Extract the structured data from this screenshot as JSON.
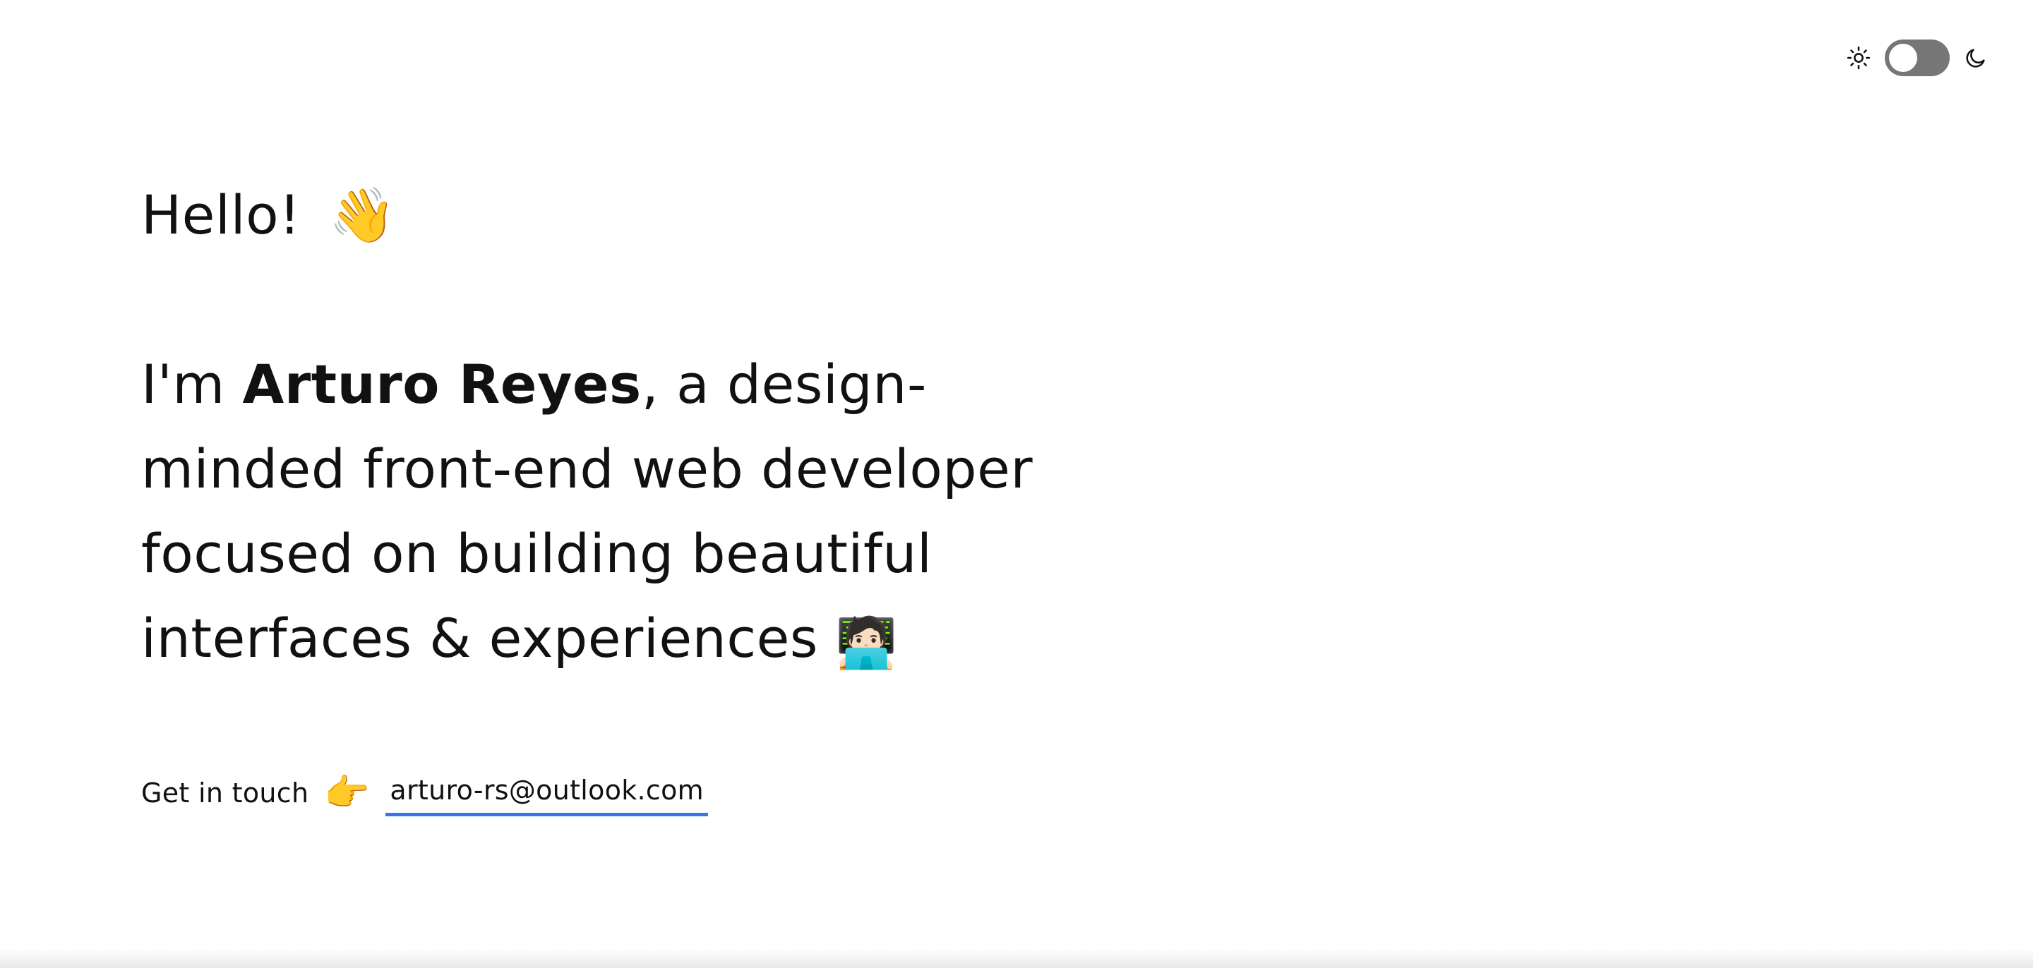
{
  "theme_toggle": {
    "left_icon": "sun-icon",
    "right_icon": "moon-icon",
    "state": "light",
    "track_color": "#767676"
  },
  "hero": {
    "greeting": "Hello!",
    "greeting_emoji": "👋",
    "intro_prefix": "I'm ",
    "name": "Arturo Reyes",
    "intro_suffix": ", a design-minded front-end web developer focused on building beautiful interfaces & experiences",
    "intro_emoji": "🧑🏻‍💻"
  },
  "contact": {
    "label": "Get in touch",
    "emoji": "👉",
    "email": "arturo-rs@outlook.com",
    "link_underline_color": "#3a75e8"
  }
}
